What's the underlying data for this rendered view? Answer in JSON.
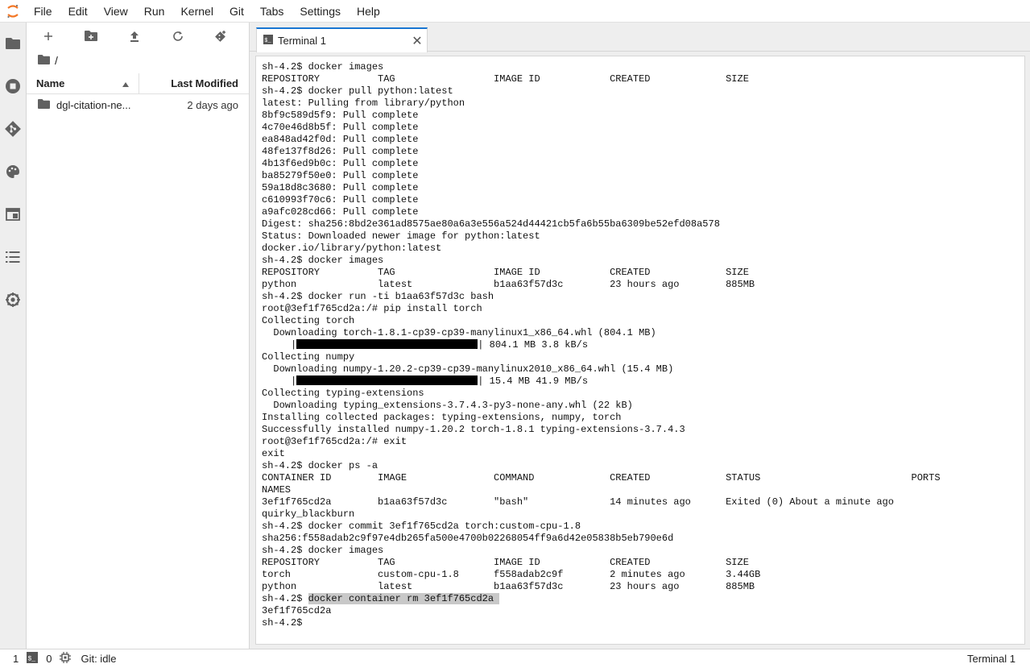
{
  "menubar": {
    "logo_icon": "jupyter-logo",
    "items": [
      "File",
      "Edit",
      "View",
      "Run",
      "Kernel",
      "Git",
      "Tabs",
      "Settings",
      "Help"
    ]
  },
  "activity_bar": {
    "icons": [
      "folder-icon",
      "running-icon",
      "git-icon",
      "palette-icon",
      "tabs-icon",
      "toc-icon",
      "extension-icon"
    ]
  },
  "file_browser": {
    "toolbar_icons": [
      "new-launcher-icon",
      "new-folder-icon",
      "upload-icon",
      "refresh-icon",
      "git-clone-icon"
    ],
    "breadcrumb": "/",
    "columns": {
      "name": "Name",
      "modified": "Last Modified"
    },
    "rows": [
      {
        "name": "dgl-citation-ne...",
        "modified": "2 days ago"
      }
    ]
  },
  "tabs": [
    {
      "label": "Terminal 1",
      "icon": "terminal-icon"
    }
  ],
  "terminal": {
    "lines": [
      "sh-4.2$ docker images",
      "REPOSITORY          TAG                 IMAGE ID            CREATED             SIZE",
      "sh-4.2$ docker pull python:latest",
      "latest: Pulling from library/python",
      "8bf9c589d5f9: Pull complete",
      "4c70e46d8b5f: Pull complete",
      "ea848ad42f0d: Pull complete",
      "48fe137f8d26: Pull complete",
      "4b13f6ed9b0c: Pull complete",
      "ba85279f50e0: Pull complete",
      "59a18d8c3680: Pull complete",
      "c610993f70c6: Pull complete",
      "a9afc028cd66: Pull complete",
      "Digest: sha256:8bd2e361ad8575ae80a6a3e556a524d44421cb5fa6b55ba6309be52efd08a578",
      "Status: Downloaded newer image for python:latest",
      "docker.io/library/python:latest",
      "sh-4.2$ docker images",
      "REPOSITORY          TAG                 IMAGE ID            CREATED             SIZE",
      "python              latest              b1aa63f57d3c        23 hours ago        885MB",
      "sh-4.2$ docker run -ti b1aa63f57d3c bash",
      "root@3ef1f765cd2a:/# pip install torch",
      "Collecting torch",
      "  Downloading torch-1.8.1-cp39-cp39-manylinux1_x86_64.whl (804.1 MB)",
      "     |",
      "Collecting numpy",
      "  Downloading numpy-1.20.2-cp39-cp39-manylinux2010_x86_64.whl (15.4 MB)",
      "     |",
      "Collecting typing-extensions",
      "  Downloading typing_extensions-3.7.4.3-py3-none-any.whl (22 kB)",
      "Installing collected packages: typing-extensions, numpy, torch",
      "Successfully installed numpy-1.20.2 torch-1.8.1 typing-extensions-3.7.4.3",
      "root@3ef1f765cd2a:/# exit",
      "exit",
      "sh-4.2$ docker ps -a",
      "CONTAINER ID        IMAGE               COMMAND             CREATED             STATUS                          PORTS",
      "NAMES",
      "3ef1f765cd2a        b1aa63f57d3c        \"bash\"              14 minutes ago      Exited (0) About a minute ago",
      "quirky_blackburn",
      "sh-4.2$ docker commit 3ef1f765cd2a torch:custom-cpu-1.8",
      "sha256:f558adab2c9f97e4db265fa500e4700b02268054ff9a6d42e05838b5eb790e6d",
      "sh-4.2$ docker images",
      "REPOSITORY          TAG                 IMAGE ID            CREATED             SIZE",
      "torch               custom-cpu-1.8      f558adab2c9f        2 minutes ago       3.44GB",
      "python              latest              b1aa63f57d3c        23 hours ago        885MB",
      "sh-4.2$ ",
      "3ef1f765cd2a",
      "sh-4.2$"
    ],
    "progress_1_text": "| 804.1 MB 3.8 kB/s",
    "progress_1_fraction": 1.0,
    "progress_2_text": "| 15.4 MB 41.9 MB/s",
    "progress_2_fraction": 1.0,
    "highlighted_command": "docker container rm 3ef1f765cd2a "
  },
  "statusbar": {
    "count_1": "1",
    "count_2": "0",
    "git_status": "Git: idle",
    "active_tab": "Terminal 1"
  }
}
